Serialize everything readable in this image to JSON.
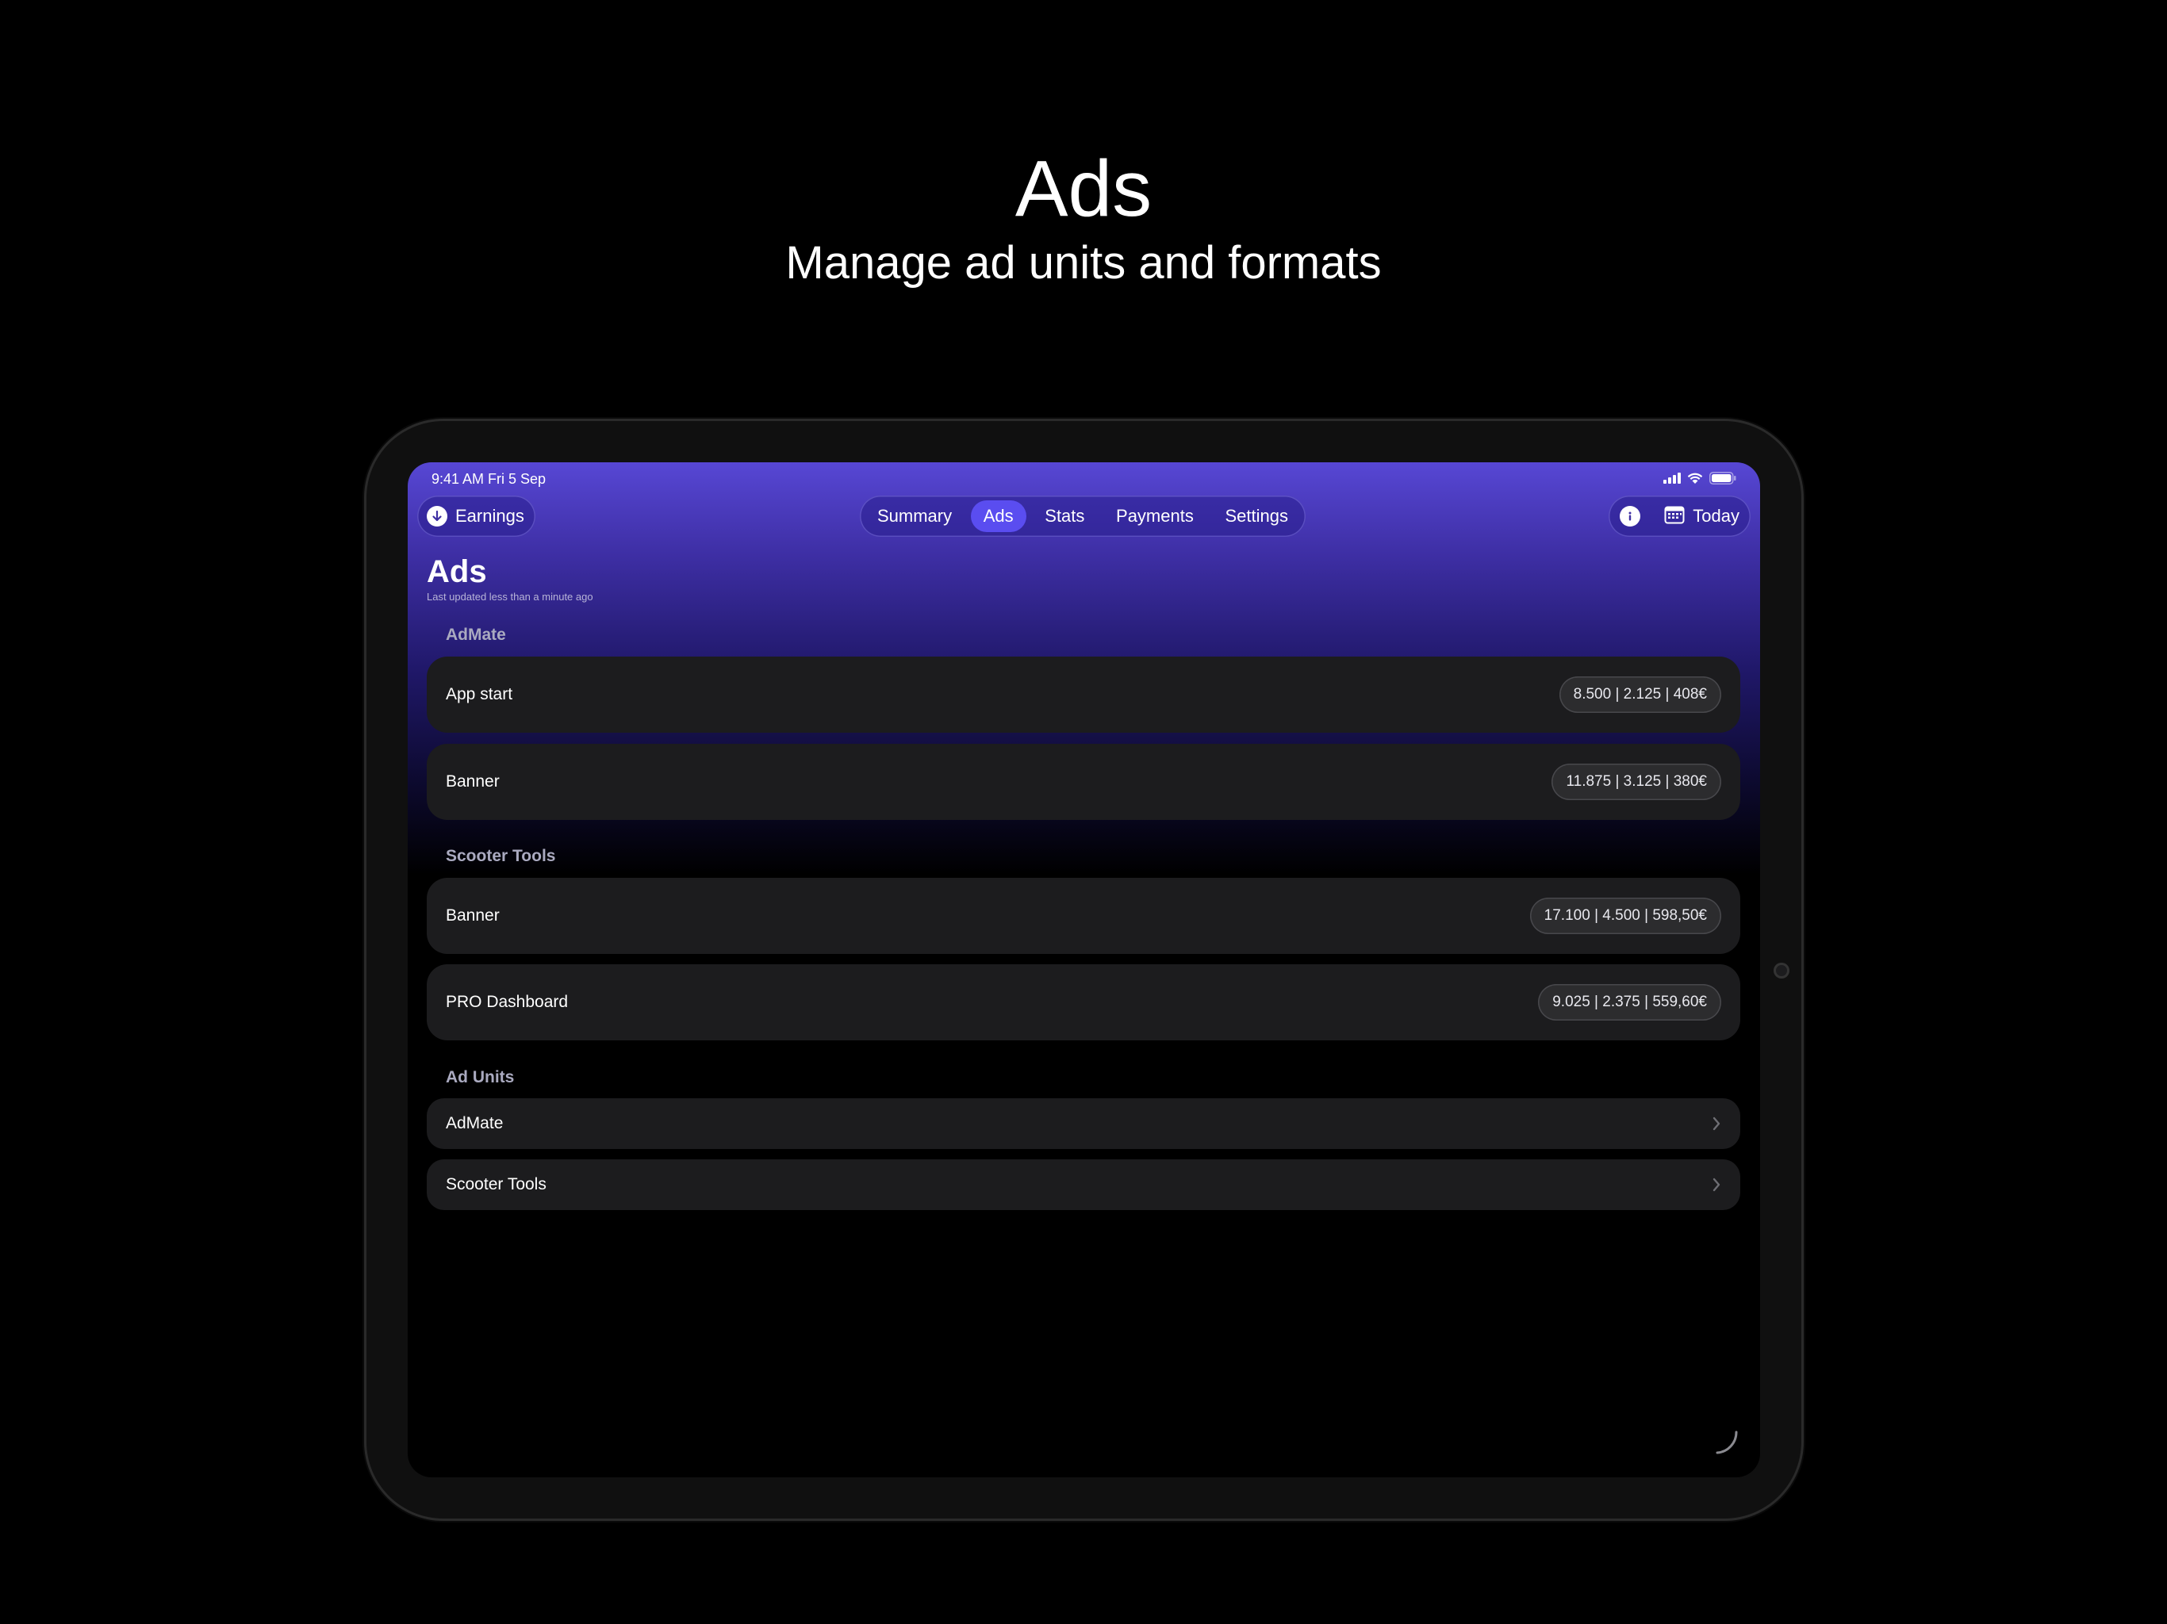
{
  "headline": {
    "title": "Ads",
    "subtitle": "Manage ad units and formats"
  },
  "status_bar": {
    "time": "9:41 AM   Fri 5 Sep"
  },
  "nav": {
    "earnings_label": "Earnings",
    "tabs": [
      {
        "label": "Summary"
      },
      {
        "label": "Ads"
      },
      {
        "label": "Stats"
      },
      {
        "label": "Payments"
      },
      {
        "label": "Settings"
      }
    ],
    "active_tab": "Ads",
    "date_label": "Today"
  },
  "page": {
    "title": "Ads",
    "updated": "Last updated less than a minute ago"
  },
  "sections": [
    {
      "label": "AdMate",
      "rows": [
        {
          "title": "App start",
          "stats": "8.500 | 2.125 | 408€"
        },
        {
          "title": "Banner",
          "stats": "11.875 | 3.125 | 380€"
        }
      ]
    },
    {
      "label": "Scooter Tools",
      "rows": [
        {
          "title": "Banner",
          "stats": "17.100 | 4.500 | 598,50€"
        },
        {
          "title": "PRO Dashboard",
          "stats": "9.025 | 2.375 | 559,60€"
        }
      ]
    }
  ],
  "ad_units": {
    "label": "Ad Units",
    "items": [
      {
        "title": "AdMate"
      },
      {
        "title": "Scooter Tools"
      }
    ]
  },
  "colors": {
    "accent": "#5a4df0",
    "header_gradient_top": "#5747d4",
    "card_background": "#1c1c1e",
    "page_background": "#000000"
  },
  "icons": {
    "earnings": "arrow-down-circle-icon",
    "info": "info-icon",
    "calendar": "calendar-icon",
    "chevron": "chevron-right-icon"
  }
}
